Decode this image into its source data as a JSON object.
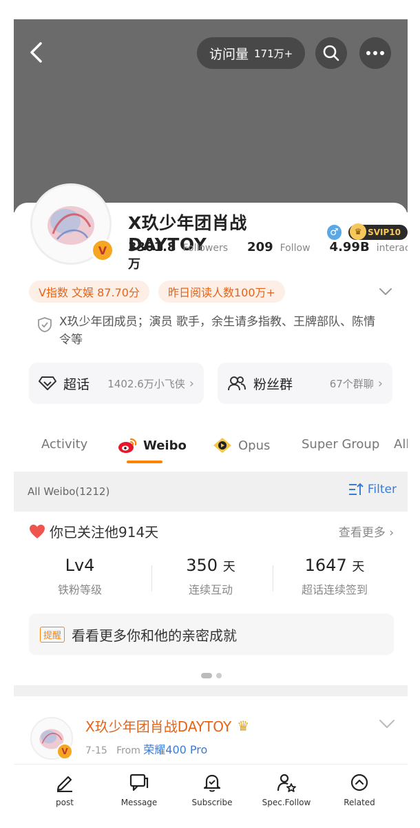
{
  "header": {
    "visit_label": "访问量",
    "visit_value": "171万+",
    "icons": [
      "back-icon",
      "search-icon",
      "more-icon"
    ]
  },
  "profile": {
    "name": "X玖少年团肖战DAYTOY",
    "svip": "SVIP10",
    "v_badge": "V",
    "stats": [
      {
        "num": "3301.8万",
        "label": "Followers"
      },
      {
        "num": "209",
        "label": "Follow"
      },
      {
        "num": "4.99B",
        "label": "interaction"
      }
    ],
    "tags": [
      "V指数 文娱 87.70分",
      "昨日阅读人数100万+"
    ],
    "bio": "X玖少年团成员；演员 歌手，余生请多指教、王牌部队、陈情令等",
    "entries": [
      {
        "title": "超话",
        "sub": "1402.6万小飞侠"
      },
      {
        "title": "粉丝群",
        "sub": "67个群聊"
      }
    ]
  },
  "tabs": [
    {
      "label": "Activity"
    },
    {
      "label": "Weibo"
    },
    {
      "label": "Opus"
    },
    {
      "label": "Super Group"
    },
    {
      "label": "Albu"
    }
  ],
  "filter_bar": {
    "all_label": "All Weibo(1212)",
    "filter_label": "Filter"
  },
  "follow_card": {
    "days_text": "你已关注他914天",
    "see_more": "查看更多",
    "metrics": [
      {
        "value": "Lv4",
        "unit": "",
        "label": "铁粉等级"
      },
      {
        "value": "350",
        "unit": "天",
        "label": "连续互动"
      },
      {
        "value": "1647",
        "unit": "天",
        "label": "超话连续签到"
      }
    ],
    "tip_tag": "提醒",
    "tip_text": "看看更多你和他的亲密成就"
  },
  "post": {
    "name": "X玖少年团肖战DAYTOY",
    "date": "7-15",
    "from_label": "From",
    "device": "荣耀400 Pro"
  },
  "bottom_nav": [
    {
      "label": "post",
      "icon": "pen-icon"
    },
    {
      "label": "Message",
      "icon": "message-icon"
    },
    {
      "label": "Subscribe",
      "icon": "bell-icon"
    },
    {
      "label": "Spec.Follow",
      "icon": "special-follow-icon"
    },
    {
      "label": "Related",
      "icon": "related-icon"
    }
  ],
  "colors": {
    "accent": "#ff8200",
    "tag_text": "#e4641a",
    "tag_bg": "#fdeee6",
    "link": "#3a7bd5",
    "cover": "#6b6b6b"
  }
}
